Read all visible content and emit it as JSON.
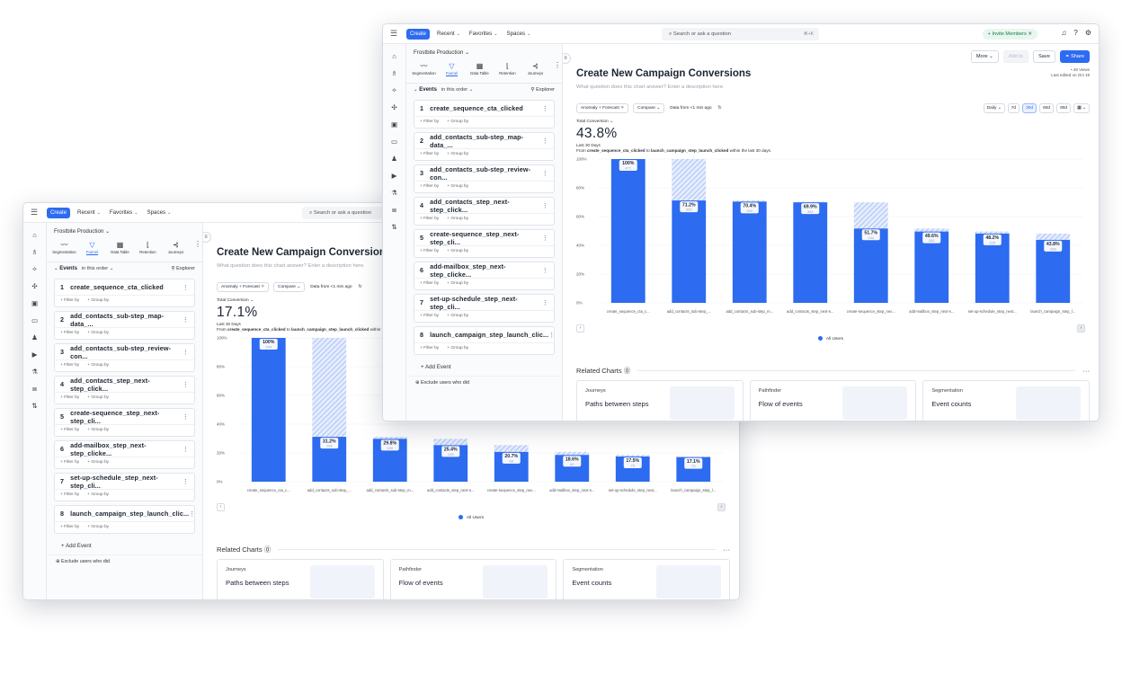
{
  "screen": {
    "nav": {
      "create": "Create",
      "recent": "Recent",
      "favorites": "Favorites",
      "spaces": "Spaces"
    },
    "search": {
      "placeholder": "Search or ask a question",
      "shortcut": "⌘+K"
    },
    "invite": "Invite Members",
    "project": "Frostbite Production",
    "view_tabs": [
      "Segmentation",
      "Funnel",
      "Data Table",
      "Retention",
      "Journeys"
    ],
    "events_label": "Events",
    "order_label": "in this order",
    "explorer_label": "Explorer",
    "filter_by": "+ Filter by",
    "group_by": "+ Group by",
    "add_event": "+ Add Event",
    "exclude": "Exclude users who did",
    "steps": [
      {
        "n": "1",
        "name": "create_sequence_cta_clicked"
      },
      {
        "n": "2",
        "name": "add_contacts_sub-step_map-data_..."
      },
      {
        "n": "3",
        "name": "add_contacts_sub-step_review-con..."
      },
      {
        "n": "4",
        "name": "add_contacts_step_next-step_click..."
      },
      {
        "n": "5",
        "name": "create-sequence_step_next-step_cli..."
      },
      {
        "n": "6",
        "name": "add-mailbox_step_next-step_clicke..."
      },
      {
        "n": "7",
        "name": "set-up-schedule_step_next-step_cli..."
      },
      {
        "n": "8",
        "name": "launch_campaign_step_launch_clic..."
      }
    ],
    "title": "Create New Campaign Conversions",
    "description": "What question does this chart answer? Enter a description here.",
    "buttons": {
      "more": "More",
      "add_to": "Add to",
      "save": "Save",
      "share": "Share"
    },
    "views": "• 48 Views",
    "edited": "Last edited on Oct 19",
    "controls": {
      "anomaly": "Anomaly + Forecast",
      "compare": "Compare",
      "data_from": "Data from <1 min ago"
    },
    "granularity": "Daily",
    "ranges": [
      "7d",
      "30d",
      "60d",
      "90d"
    ],
    "total_conversion_label": "Total Conversion",
    "period": "Last 30 Days",
    "from_text": "From",
    "to_text": "to",
    "within_text": "within the last 30 days.",
    "from_event": "create_sequence_cta_clicked",
    "to_event": "launch_campaign_step_launch_clicked",
    "legend": "All Users",
    "related": {
      "title": "Related Charts",
      "cards": [
        {
          "type": "Journeys",
          "title": "Paths between steps"
        },
        {
          "type": "Pathfinder",
          "title": "Flow of events"
        },
        {
          "type": "Segmentation",
          "title": "Event counts"
        }
      ]
    },
    "colors": {
      "accent": "#2d6bf0",
      "forecast_hatch": "#9db8f6",
      "invite_bg": "#e7f6ee"
    }
  },
  "windows": [
    {
      "total_conversion": "17.1%",
      "chart_data": {
        "type": "bar",
        "categories": [
          "create_sequence_cta_c...",
          "add_contacts_sub-step_...",
          "add_contacts_sub-step_m...",
          "add_contacts_step_next-s...",
          "create-sequence_step_nex...",
          "add-mailbox_step_next-s...",
          "set-up-schedule_step_next...",
          "launch_campaign_step_l..."
        ],
        "series": [
          {
            "name": "All Users",
            "values": [
              100,
              31.2,
              29.8,
              25.4,
              20.7,
              18.6,
              17.5,
              17.1
            ]
          }
        ],
        "forecast_tops": [
          100,
          100,
          31.2,
          29.8,
          25.4,
          20.7,
          18.6,
          17.5
        ],
        "labels": [
          "100%",
          "31.2%",
          "29.8%",
          "25.4%",
          "20.7%",
          "18.6%",
          "17.5%",
          "17.1%"
        ],
        "counts": [
          "334",
          "104",
          "100",
          "109",
          "69",
          "60",
          "75",
          "73"
        ],
        "yticks": [
          "0%",
          "20%",
          "40%",
          "60%",
          "80%",
          "100%"
        ],
        "ylim": [
          0,
          100
        ]
      }
    },
    {
      "total_conversion": "43.8%",
      "chart_data": {
        "type": "bar",
        "categories": [
          "create_sequence_cta_c...",
          "add_contacts_sub-step_...",
          "add_contacts_sub-step_m...",
          "add_contacts_step_next-s...",
          "create-sequence_step_nex...",
          "add-mailbox_step_next-s...",
          "set-up-schedule_step_next...",
          "launch_campaign_step_l..."
        ],
        "series": [
          {
            "name": "All Users",
            "values": [
              100,
              71.2,
              70.4,
              69.9,
              51.7,
              49.6,
              48.2,
              43.8
            ]
          }
        ],
        "forecast_tops": [
          100,
          100,
          71.2,
          70.4,
          69.9,
          51.7,
          49.6,
          48.2
        ],
        "labels": [
          "100%",
          "71.2%",
          "70.4%",
          "69.9%",
          "51.7%",
          "49.6%",
          "48.2%",
          "43.8%"
        ],
        "counts": [
          "471",
          "335",
          "400",
          "394",
          "244",
          "282",
          "225",
          "208"
        ],
        "yticks": [
          "0%",
          "20%",
          "40%",
          "60%",
          "80%",
          "100%"
        ],
        "ylim": [
          0,
          100
        ]
      }
    }
  ]
}
